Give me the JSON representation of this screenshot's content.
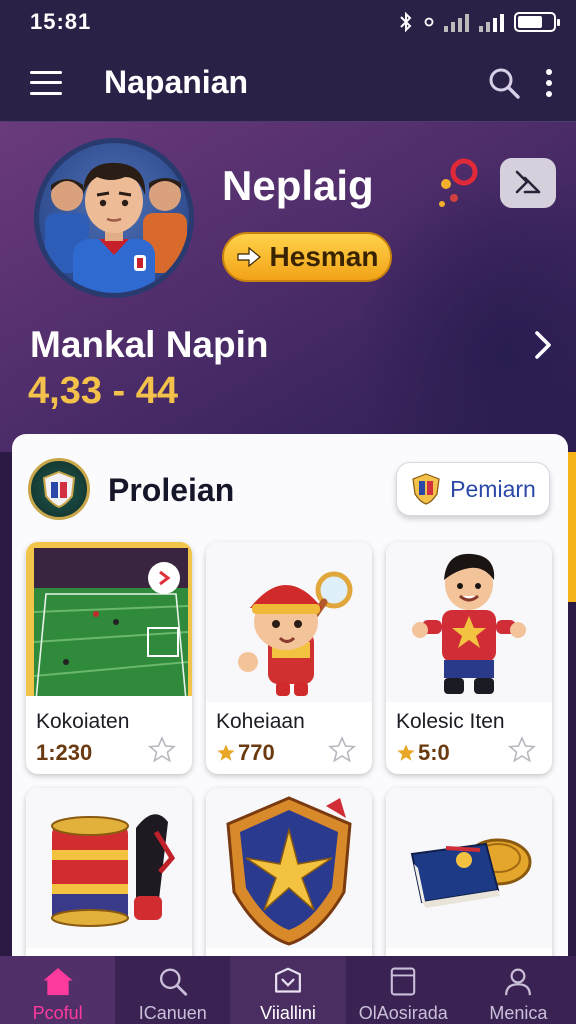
{
  "status": {
    "time": "15:81"
  },
  "app_bar": {
    "title": "Napanian",
    "search_icon": "search-icon",
    "more_icon": "more-vertical-icon"
  },
  "profile": {
    "name": "Neplaig",
    "badge_label": "Hesman",
    "section_title": "Mankal Napin",
    "score": "4,33 - 44"
  },
  "panel": {
    "title": "Proleian",
    "premium_label": "Pemiarn"
  },
  "tiles": [
    {
      "label": "Kokoiaten",
      "value": "1:230",
      "show_star": false,
      "icon": "stadium-image"
    },
    {
      "label": "Koheiaan",
      "value": "770",
      "show_star": true,
      "icon": "mascot-magnifier-image"
    },
    {
      "label": "Kolesic Iten",
      "value": "5:0",
      "show_star": true,
      "icon": "player-character-image"
    },
    {
      "label": "",
      "value": "",
      "show_star": false,
      "icon": "drum-horn-image"
    },
    {
      "label": "",
      "value": "",
      "show_star": false,
      "icon": "shield-emblem-image"
    },
    {
      "label": "",
      "value": "",
      "show_star": false,
      "icon": "book-coin-image"
    }
  ],
  "nav": [
    {
      "label": "Pcoful",
      "icon": "home-icon"
    },
    {
      "label": "ICanuen",
      "icon": "search-icon"
    },
    {
      "label": "Viiallini",
      "icon": "shield-icon"
    },
    {
      "label": "OlAosirada",
      "icon": "card-icon"
    },
    {
      "label": "Menica",
      "icon": "person-icon"
    }
  ],
  "colors": {
    "accent": "#ff3a9d",
    "gold": "#f4c24a",
    "bar": "#2b2046",
    "nav": "#3a2353"
  }
}
